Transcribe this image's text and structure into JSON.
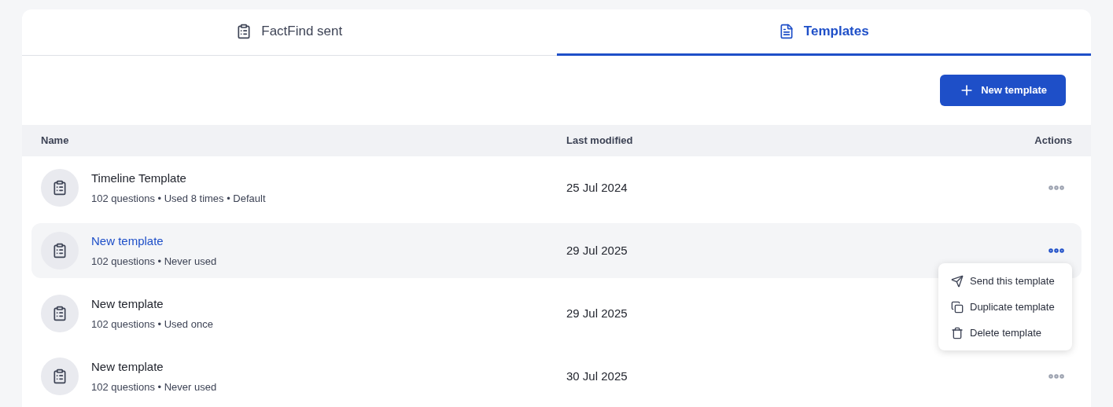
{
  "tabs": [
    {
      "label": "FactFind sent",
      "kind": "clipboard",
      "selected": false
    },
    {
      "label": "Templates",
      "kind": "document",
      "selected": true
    }
  ],
  "new_button": {
    "label": "New template"
  },
  "table": {
    "columns": [
      "Name",
      "Last modified",
      "Actions"
    ],
    "rows": [
      {
        "name": "Timeline Template",
        "details": "102 questions • Used 8 times • Default",
        "modified": "25 Jul 2024",
        "selected": false,
        "menu_open": false
      },
      {
        "name": "New template",
        "details": "102 questions • Never used",
        "modified": "29 Jul 2025",
        "selected": true,
        "menu_open": true
      },
      {
        "name": "New template",
        "details": "102 questions • Used once",
        "modified": "29 Jul 2025",
        "selected": false,
        "menu_open": false
      },
      {
        "name": "New template",
        "details": "102 questions • Never used",
        "modified": "30 Jul 2025",
        "selected": false,
        "menu_open": false
      }
    ]
  },
  "row_menu": [
    {
      "label": "Send this template",
      "kind": "send"
    },
    {
      "label": "Duplicate template",
      "kind": "duplicate"
    },
    {
      "label": "Delete template",
      "kind": "delete"
    }
  ]
}
